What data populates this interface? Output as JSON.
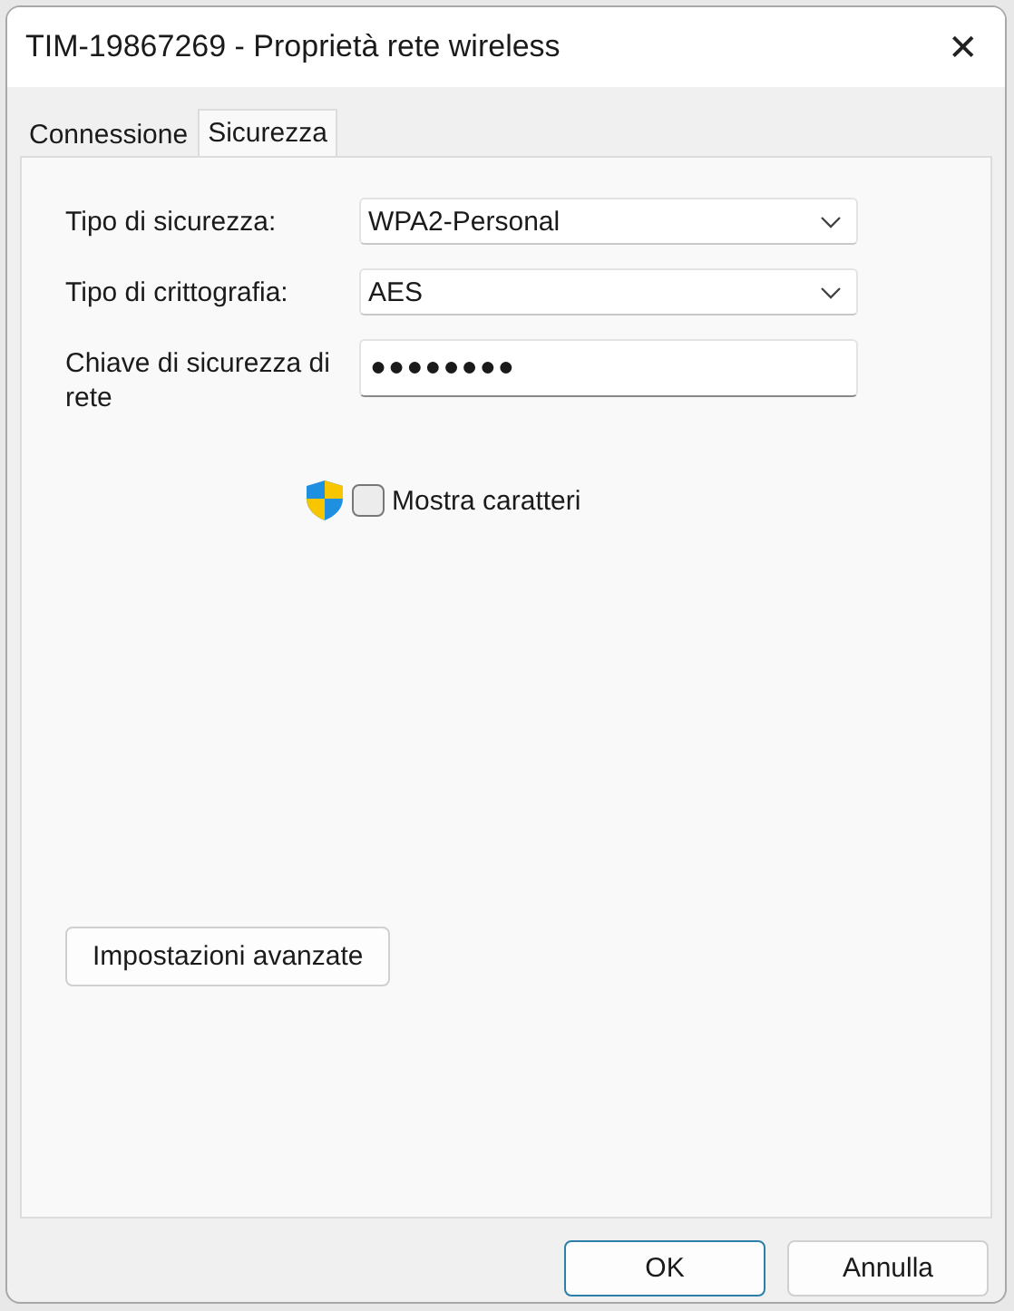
{
  "window": {
    "title": "TIM-19867269 - Proprietà rete wireless",
    "close": "✕"
  },
  "tabs": [
    {
      "label": "Connessione",
      "selected": false
    },
    {
      "label": "Sicurezza",
      "selected": true
    }
  ],
  "fields": [
    {
      "kind": "dropdown",
      "label": "Tipo di sicurezza:",
      "value": "WPA2-Personal"
    },
    {
      "kind": "dropdown",
      "label": "Tipo di crittografia:",
      "value": "AES"
    },
    {
      "kind": "password",
      "label": "Chiave di sicurezza di rete",
      "value": "●●●●●●●●"
    }
  ],
  "show_characters": {
    "label": "Mostra caratteri",
    "checked": false
  },
  "advanced_button": "Impostazioni avanzate",
  "buttons": [
    {
      "label": "OK",
      "default": true
    },
    {
      "label": "Annulla",
      "default": false
    }
  ]
}
